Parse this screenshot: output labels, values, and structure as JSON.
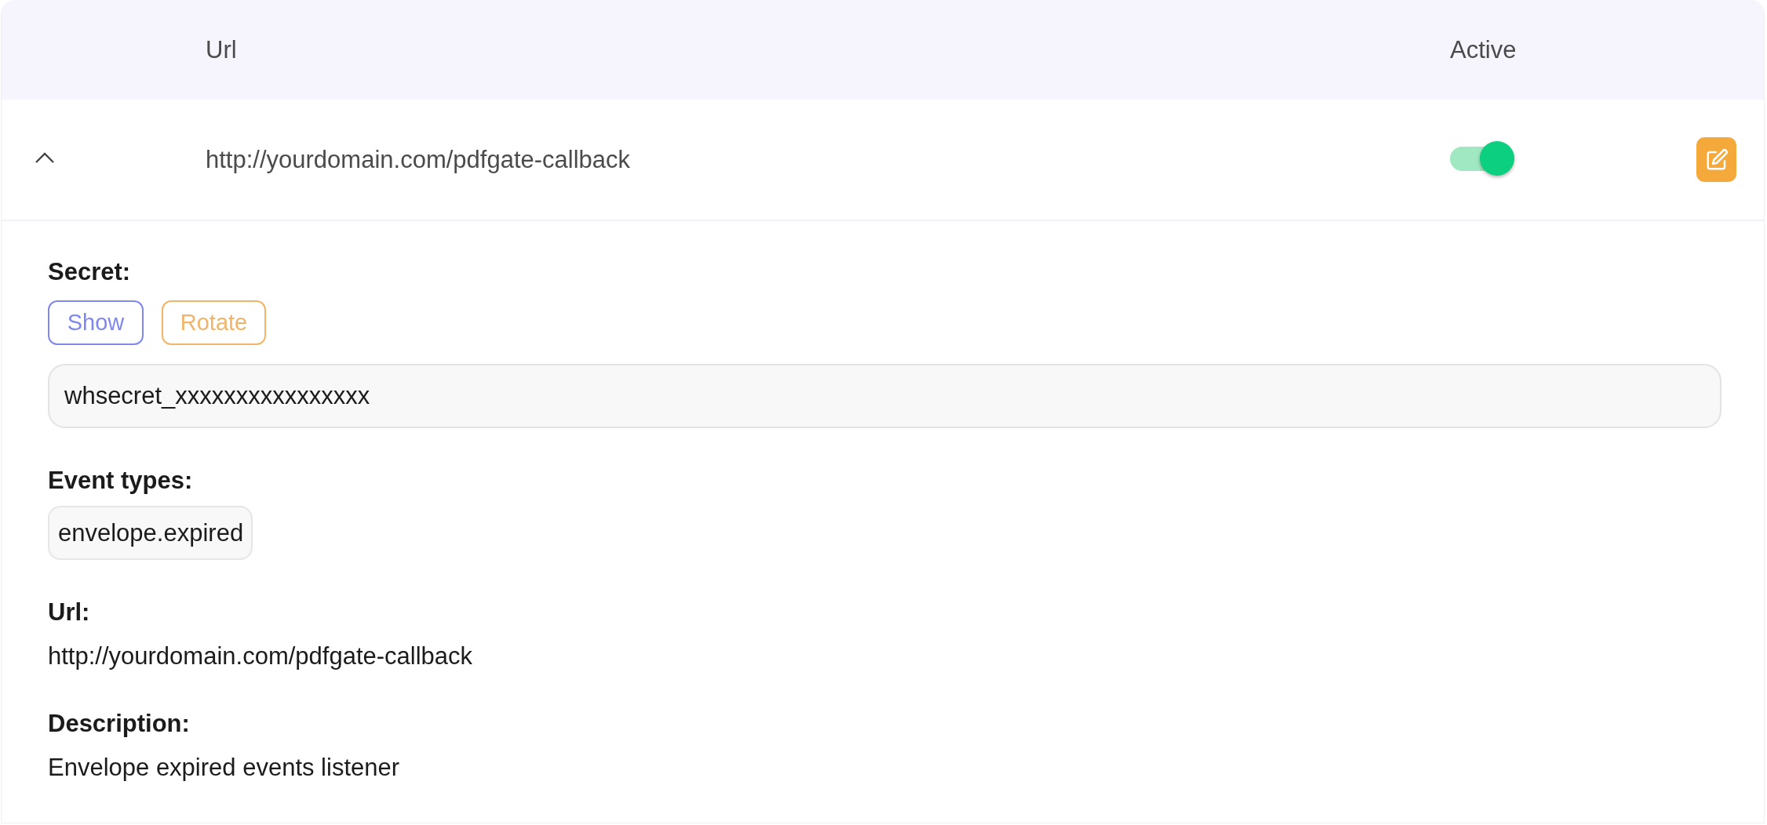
{
  "table": {
    "columns": [
      {
        "label": "Url"
      },
      {
        "label": "Active"
      }
    ],
    "rows": [
      {
        "expanded": true,
        "url": "http://yourdomain.com/pdfgate-callback",
        "active": true,
        "details": {
          "secret": {
            "label": "Secret:",
            "buttons": [
              {
                "label": "Show",
                "kind": "show"
              },
              {
                "label": "Rotate",
                "kind": "rotate"
              }
            ],
            "value": "whsecret_xxxxxxxxxxxxxxxx"
          },
          "event_types": {
            "label": "Event types:",
            "items": [
              "envelope.expired"
            ]
          },
          "url": {
            "label": "Url:",
            "value": "http://yourdomain.com/pdfgate-callback"
          },
          "description": {
            "label": "Description:",
            "value": "Envelope expired events listener"
          }
        }
      }
    ]
  }
}
